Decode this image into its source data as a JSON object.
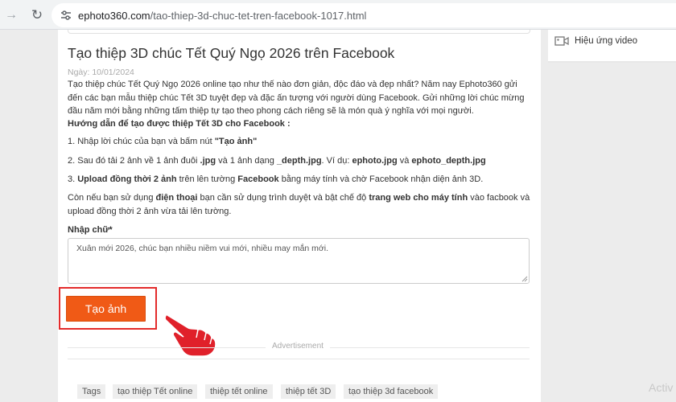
{
  "browser": {
    "url_host": "ephoto360.com",
    "url_path": "/tao-thiep-3d-chuc-tet-tren-facebook-1017.html"
  },
  "article": {
    "title": "Tạo thiệp 3D chúc Tết Quý Ngọ 2026 trên Facebook",
    "date": "Ngày: 10/01/2024",
    "intro": "Tạo thiệp chúc Tết Quý Ngọ 2026 online tạo như thế nào đơn giản, độc đáo và đẹp nhất? Năm nay Ephoto360 gửi đến các bạn mẫu thiệp chúc Tết 3D tuyệt đẹp và đặc ấn tượng với người dùng Facebook. Gửi những lời chúc mừng đầu năm mới bằng những tấm thiệp tự tạo theo phong cách riêng sẽ là món quà ý nghĩa với mọi người.",
    "guide_heading": "Hướng dẫn để tạo được thiệp Tết 3D cho Facebook :",
    "step1_text": "1. Nhập lời chúc của bạn và bấm nút ",
    "step1_bold": "\"Tạo ảnh\"",
    "step2_a": "2. Sau đó tải 2 ảnh  về 1 ảnh  đuôi ",
    "step2_b": ".jpg",
    "step2_c": " và 1 ảnh  dạng ",
    "step2_d": "_depth.jpg",
    "step2_e": ".  Ví dụ: ",
    "step2_f": "ephoto.jpg",
    "step2_g": " và ",
    "step2_h": "ephoto_depth.jpg",
    "step3_a": "3. ",
    "step3_b": "Upload đồng thời 2 ảnh",
    "step3_c": " trên lên tường ",
    "step3_d": "Facebook",
    "step3_e": " bằng máy tính và chờ Facebook nhận diện ảnh 3D.",
    "mobile_a": " Còn nếu bạn sử dụng ",
    "mobile_b": "điện thoại",
    "mobile_c": " bạn cần sử dụng trình duyệt và bật chế độ ",
    "mobile_d": "trang web cho máy tính",
    "mobile_e": " vào facbook và upload đồng thời 2 ảnh vừa tải lên tường."
  },
  "form": {
    "input_label": "Nhập chữ*",
    "input_value": "Xuân mới 2026, chúc bạn nhiều niềm vui mới, nhiều may mắn mới.",
    "submit_label": "Tạo ảnh"
  },
  "ad": {
    "label": "Advertisement"
  },
  "tags": {
    "label": "Tags",
    "items": [
      "tạo thiệp Tết online",
      "thiệp tết online",
      "thiệp tết 3D",
      "tạo thiệp 3d facebook"
    ]
  },
  "sidebar": {
    "video_label": "Hiệu ứng video"
  },
  "watermark": "Activ",
  "colors": {
    "accent_button": "#f05a16",
    "highlight_border": "#e32b2b",
    "pointer_hand": "#e0202a"
  },
  "icons": {
    "back": "arrow-right-icon",
    "reload": "reload-icon",
    "site": "site-info-icon",
    "video": "video-icon",
    "pointer": "pointing-hand-icon"
  }
}
